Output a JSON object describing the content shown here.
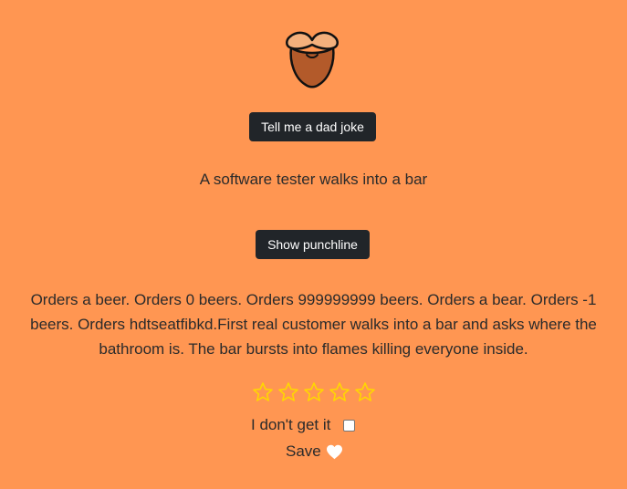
{
  "header": {
    "logo_icon": "beard-mustache-icon"
  },
  "joke": {
    "button_label": "Tell me a dad joke",
    "setup": "A software tester walks into a bar",
    "punchline_button_label": "Show punchline",
    "punchline": "Orders a beer. Orders 0 beers. Orders 999999999 beers. Orders a bear. Orders -1 beers. Orders hdtseatfibkd.First real customer walks into a bar and asks where the bathroom is. The bar bursts into flames killing everyone inside."
  },
  "rating": {
    "max_stars": 5,
    "value": 0,
    "star_icon": "star-outline-icon",
    "star_color": "#ffd700"
  },
  "feedback": {
    "dont_get_it_label": "I don't get it",
    "dont_get_it_checked": false,
    "save_label": "Save",
    "save_icon": "heart-icon",
    "heart_color": "#ffffff"
  },
  "theme": {
    "background": "#ff9652",
    "button_bg": "#212529",
    "button_text": "#ffffff"
  }
}
